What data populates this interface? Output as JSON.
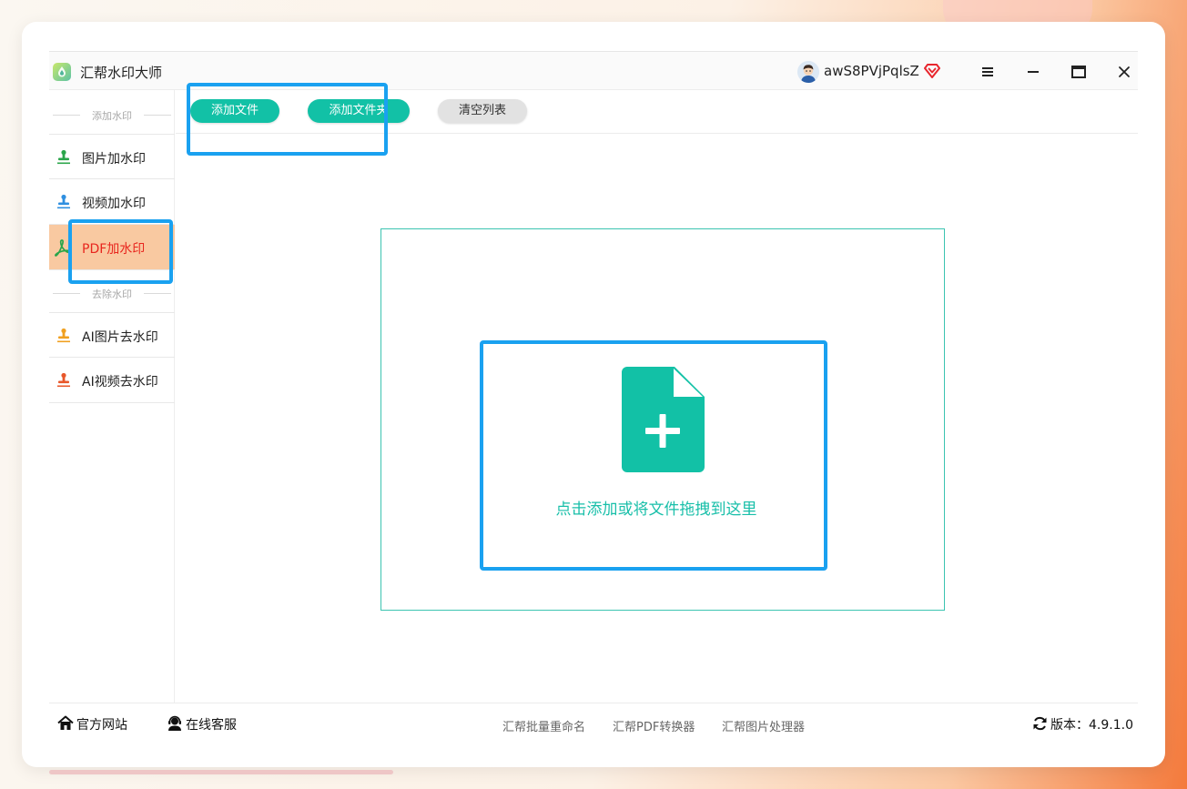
{
  "app": {
    "title": "汇帮水印大师"
  },
  "user": {
    "name": "awS8PVjPqlsZ"
  },
  "sidebar": {
    "section_add": "添加水印",
    "section_remove": "去除水印",
    "items": [
      {
        "label": "图片加水印",
        "icon": "stamp-icon",
        "color": "#2aa54a"
      },
      {
        "label": "视频加水印",
        "icon": "stamp-icon",
        "color": "#2f8fe0"
      },
      {
        "label": "PDF加水印",
        "icon": "pdf-icon",
        "color": "#2aa54a",
        "active": true
      },
      {
        "label": "AI图片去水印",
        "icon": "stamp-icon",
        "color": "#f0a020"
      },
      {
        "label": "AI视频去水印",
        "icon": "stamp-icon",
        "color": "#e8572a"
      }
    ]
  },
  "toolbar": {
    "add_file": "添加文件",
    "add_folder": "添加文件夹",
    "clear_list": "清空列表"
  },
  "drop": {
    "hint": "点击添加或将文件拖拽到这里"
  },
  "footer": {
    "website": "官方网站",
    "support": "在线客服",
    "tools": [
      "汇帮批量重命名",
      "汇帮PDF转换器",
      "汇帮图片处理器"
    ],
    "version_label": "版本：4.9.1.0"
  },
  "colors": {
    "accent": "#12c1a6",
    "active_bg": "#f9c9a1",
    "active_text": "#e8261e",
    "highlight": "#1aa1f0"
  }
}
